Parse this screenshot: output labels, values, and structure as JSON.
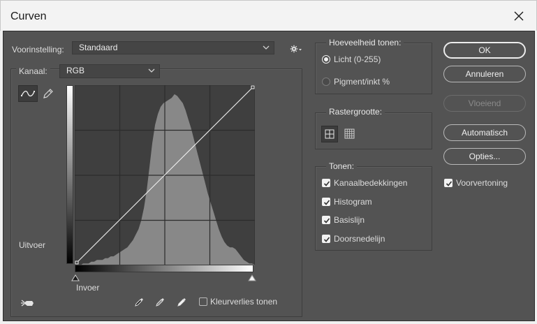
{
  "window": {
    "title": "Curven"
  },
  "preset": {
    "label": "Voorinstelling:",
    "value": "Standaard"
  },
  "channel": {
    "label": "Kanaal:",
    "value": "RGB"
  },
  "graph": {
    "output_label": "Uitvoer",
    "input_label": "Invoer"
  },
  "clipping": {
    "label": "Kleurverlies tonen",
    "checked": false
  },
  "amount": {
    "title": "Hoeveelheid tonen:",
    "options": [
      {
        "label": "Licht (0-255)",
        "selected": true
      },
      {
        "label": "Pigment/inkt %",
        "selected": false
      }
    ]
  },
  "grid_size": {
    "title": "Rastergrootte:",
    "selected": "simple"
  },
  "show": {
    "title": "Tonen:",
    "items": [
      {
        "label": "Kanaalbedekkingen",
        "checked": true
      },
      {
        "label": "Histogram",
        "checked": true
      },
      {
        "label": "Basislijn",
        "checked": true
      },
      {
        "label": "Doorsnedelijn",
        "checked": true
      }
    ]
  },
  "buttons": {
    "ok": "OK",
    "cancel": "Annuleren",
    "smooth": "Vloeiend",
    "auto": "Automatisch",
    "options": "Opties..."
  },
  "preview": {
    "label": "Voorvertoning",
    "checked": true
  },
  "histogram": [
    0,
    0,
    0,
    1,
    1,
    1,
    2,
    2,
    3,
    3,
    3,
    4,
    4,
    5,
    5,
    6,
    7,
    8,
    9,
    10,
    12,
    14,
    17,
    20,
    25,
    32,
    42,
    55,
    68,
    78,
    84,
    88,
    90,
    91,
    92,
    93,
    95,
    94,
    92,
    90,
    86,
    81,
    76,
    70,
    64,
    58,
    52,
    46,
    40,
    35,
    30,
    25,
    20,
    16,
    13,
    11,
    10,
    10,
    9,
    7,
    5,
    3,
    2,
    1,
    1,
    0
  ],
  "colors": {
    "panel": "#535353",
    "graph_bg": "#3f3f3f",
    "histogram": "#888888",
    "curve": "#ececec"
  }
}
